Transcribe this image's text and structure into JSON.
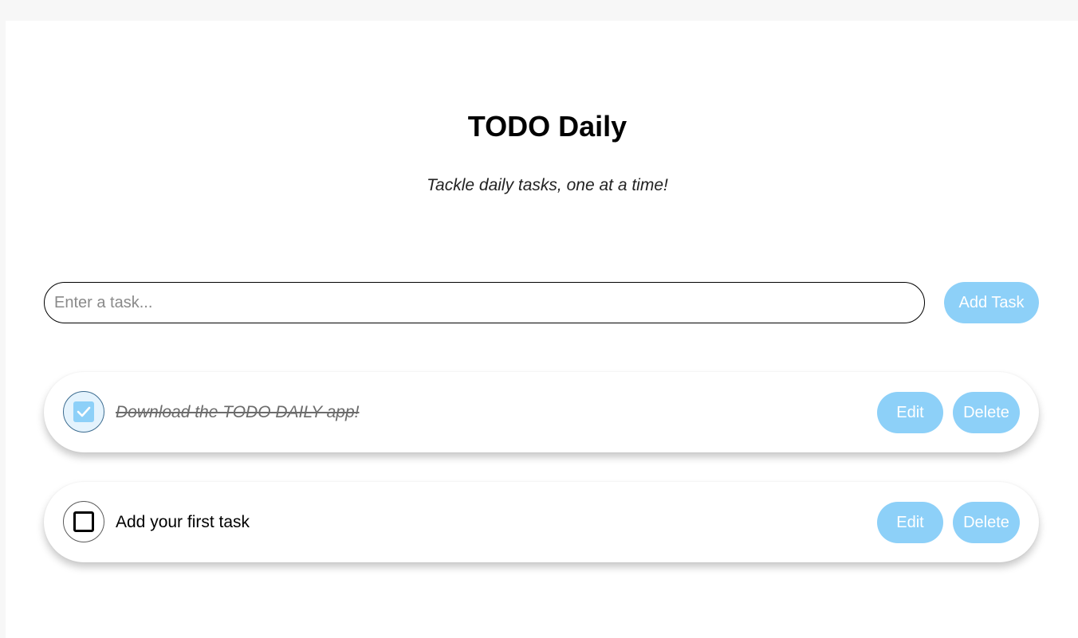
{
  "header": {
    "title": "TODO Daily",
    "subtitle": "Tackle daily tasks, one at a time!"
  },
  "new_task": {
    "placeholder": "Enter a task...",
    "add_label": "Add Task"
  },
  "tasks": [
    {
      "text": "Download the TODO DAILY app!",
      "completed": true,
      "edit_label": "Edit",
      "delete_label": "Delete"
    },
    {
      "text": "Add your first task",
      "completed": false,
      "edit_label": "Edit",
      "delete_label": "Delete"
    }
  ],
  "colors": {
    "accent": "#8dd0f8",
    "checked_bg": "#e4f3fd"
  },
  "icons": {
    "checked": "checkbox-checked-icon",
    "unchecked": "checkbox-unchecked-icon"
  }
}
